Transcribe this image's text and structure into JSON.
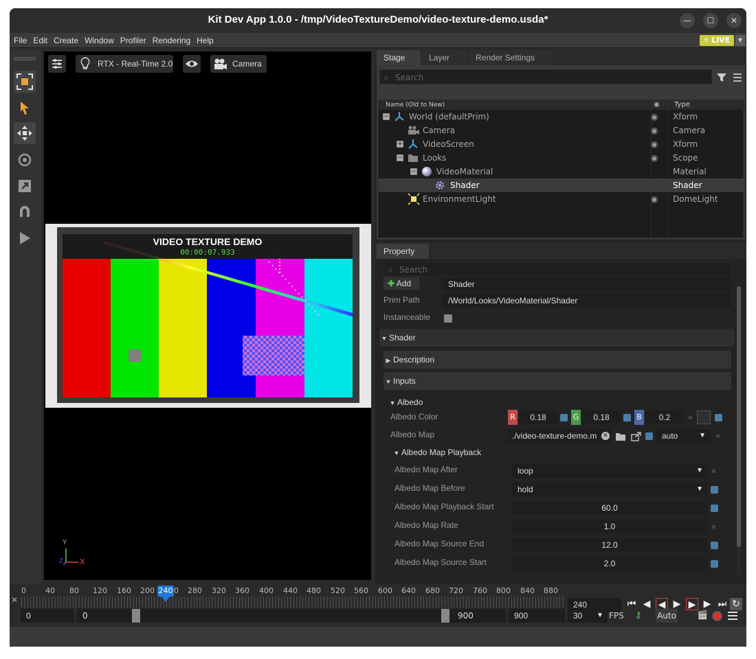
{
  "window": {
    "title": "Kit Dev App 1.0.0 - /tmp/VideoTextureDemo/video-texture-demo.usda*",
    "minimize": "—",
    "maximize": "☐",
    "close": "✕"
  },
  "menu": [
    "File",
    "Edit",
    "Create",
    "Window",
    "Profiler",
    "Rendering",
    "Help"
  ],
  "live": {
    "label": "LIVE"
  },
  "viewport": {
    "settings_icon": "sliders-icon",
    "renderer_label": "RTX - Real-Time 2.0",
    "camera_label": "Camera",
    "video_title": "VIDEO TEXTURE DEMO",
    "video_time": "00:00:07.933",
    "axis_y": "Y",
    "axis_x": "X",
    "axis_z": "Z",
    "bar_colors": [
      "#e60000",
      "#00e600",
      "#e6e600",
      "#0000e6",
      "#e600e6",
      "#00e6e6"
    ]
  },
  "stage": {
    "tabs": [
      "Stage",
      "Layer",
      "Render Settings"
    ],
    "search_placeholder": "Search",
    "col_name": "Name (Old to New)",
    "col_type": "Type",
    "rows": [
      {
        "name": "World (defaultPrim)",
        "type": "Xform"
      },
      {
        "name": "Camera",
        "type": "Camera"
      },
      {
        "name": "VideoScreen",
        "type": "Xform"
      },
      {
        "name": "Looks",
        "type": "Scope"
      },
      {
        "name": "VideoMaterial",
        "type": "Material"
      },
      {
        "name": "Shader",
        "type": "Shader"
      },
      {
        "name": "EnvironmentLight",
        "type": "DomeLight"
      }
    ]
  },
  "property": {
    "tab": "Property",
    "search_placeholder": "Search",
    "add_label": "Add",
    "name_value": "Shader",
    "prim_path_label": "Prim Path",
    "prim_path_value": "/World/Looks/VideoMaterial/Shader",
    "instanceable_label": "Instanceable",
    "shader_section": "Shader",
    "description_section": "Description",
    "inputs_section": "Inputs",
    "albedo_section": "Albedo",
    "albedo_color_label": "Albedo Color",
    "r_label": "R",
    "g_label": "G",
    "b_label": "B",
    "r_value": "0.18",
    "g_value": "0.18",
    "b_value": "0.2",
    "albedo_map_label": "Albedo Map",
    "albedo_map_value": "./video-texture-demo.m",
    "albedo_map_mode": "auto",
    "playback_section": "Albedo Map Playback",
    "fields": [
      {
        "label": "Albedo Map After",
        "value": "loop",
        "kind": "dropdown"
      },
      {
        "label": "Albedo Map Before",
        "value": "hold",
        "kind": "dropdown"
      },
      {
        "label": "Albedo Map Playback Start",
        "value": "60.0",
        "kind": "number"
      },
      {
        "label": "Albedo Map Rate",
        "value": "1.0",
        "kind": "number"
      },
      {
        "label": "Albedo Map Source End",
        "value": "12.0",
        "kind": "number"
      },
      {
        "label": "Albedo Map Source Start",
        "value": "2.0",
        "kind": "number"
      }
    ]
  },
  "timeline": {
    "ticks": [
      "0",
      "40",
      "80",
      "120",
      "160",
      "200",
      "240",
      "280",
      "320",
      "360",
      "400",
      "440",
      "480",
      "520",
      "560",
      "600",
      "640",
      "680",
      "720",
      "760",
      "800",
      "840",
      "880"
    ],
    "current_frame_marker": "240",
    "current_frame": "240",
    "start_time": "0",
    "range_start": "0",
    "range_end": "900",
    "end_time": "900",
    "fps_value": "30",
    "fps_label": "FPS",
    "auto_label": "Auto"
  }
}
